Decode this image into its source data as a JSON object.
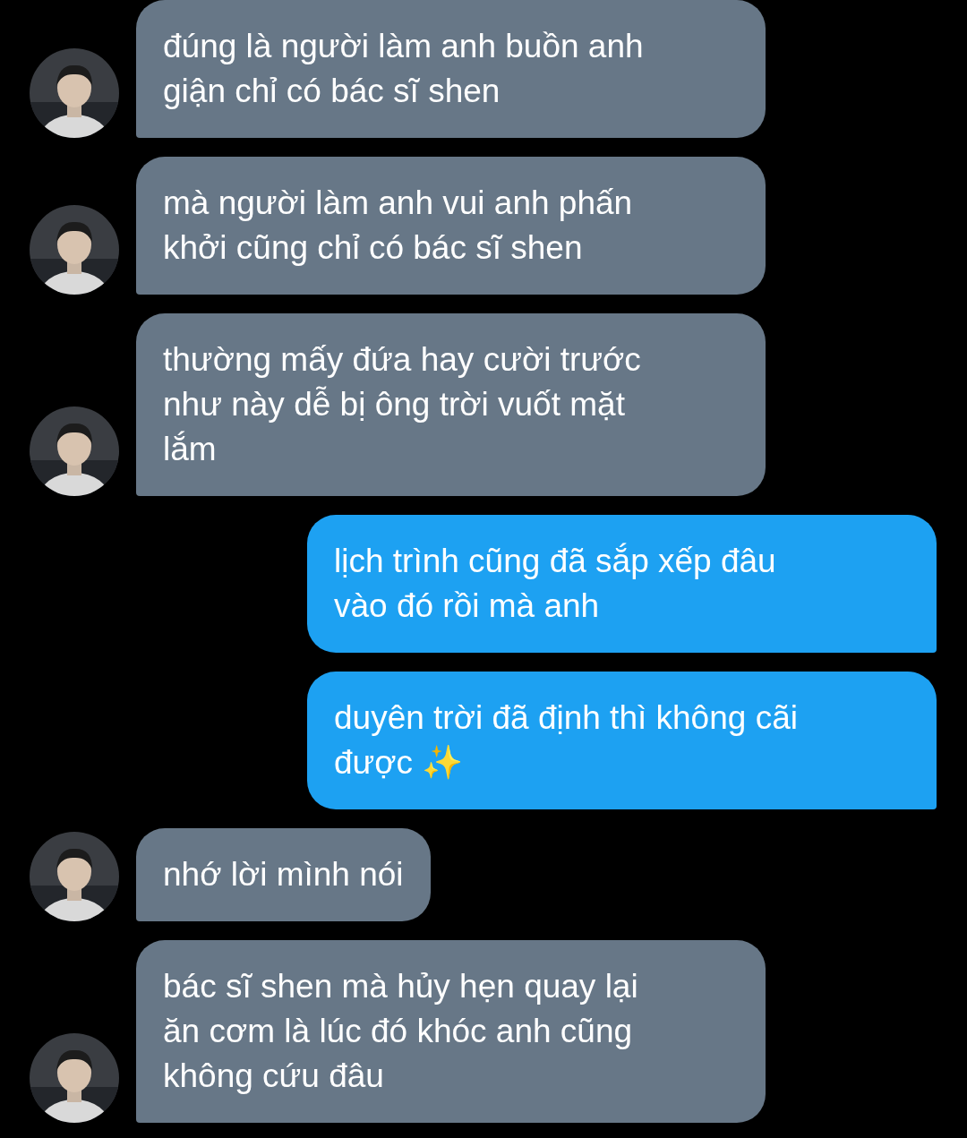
{
  "messages": [
    {
      "kind": "incoming",
      "text": "đúng là người làm anh buồn anh\ngiận chỉ có bác sĩ shen"
    },
    {
      "kind": "incoming",
      "text": "mà người làm anh vui anh phấn\nkhởi cũng chỉ có bác sĩ shen"
    },
    {
      "kind": "incoming",
      "text": "thường mấy đứa hay cười trước\nnhư này dễ bị ông trời vuốt mặt\nlắm"
    },
    {
      "kind": "outgoing",
      "text": "lịch trình cũng đã sắp xếp đâu\nvào đó rồi mà anh"
    },
    {
      "kind": "outgoing",
      "text": "duyên trời đã định thì không cãi\nđược ✨"
    },
    {
      "kind": "incoming",
      "text": "nhớ lời mình nói"
    },
    {
      "kind": "incoming",
      "text": "bác sĩ shen mà hủy hẹn quay lại\năn cơm là lúc đó khóc anh cũng\nkhông cứu đâu"
    }
  ]
}
